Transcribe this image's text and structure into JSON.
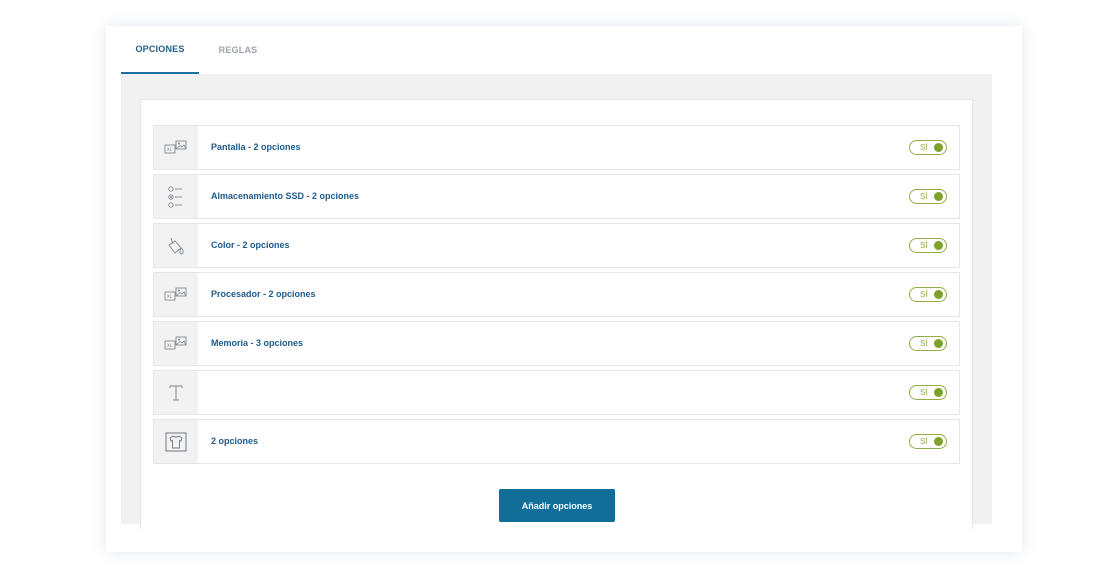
{
  "tabs": [
    {
      "label": "OPCIONES",
      "active": true
    },
    {
      "label": "REGLAS",
      "active": false
    }
  ],
  "options": [
    {
      "icon": "image-size-icon",
      "label": "Pantalla - 2 opciones",
      "toggle": "SÍ"
    },
    {
      "icon": "list-radio-icon",
      "label": "Almacenamiento SSD - 2 opciones",
      "toggle": "SÍ"
    },
    {
      "icon": "paint-bucket-icon",
      "label": "Color - 2 opciones",
      "toggle": "SÍ"
    },
    {
      "icon": "image-size-icon",
      "label": "Procesador - 2 opciones",
      "toggle": "SÍ"
    },
    {
      "icon": "image-size-icon",
      "label": "Memoria - 3 opciones",
      "toggle": "SÍ"
    },
    {
      "icon": "text-icon",
      "label": "",
      "toggle": "SÍ"
    },
    {
      "icon": "tshirt-icon",
      "label": "2 opciones",
      "toggle": "SÍ"
    }
  ],
  "add_button": "Añadir opciones",
  "colors": {
    "accent": "#106e99",
    "label_blue": "#1d5b8c",
    "toggle_green": "#7da12c"
  }
}
